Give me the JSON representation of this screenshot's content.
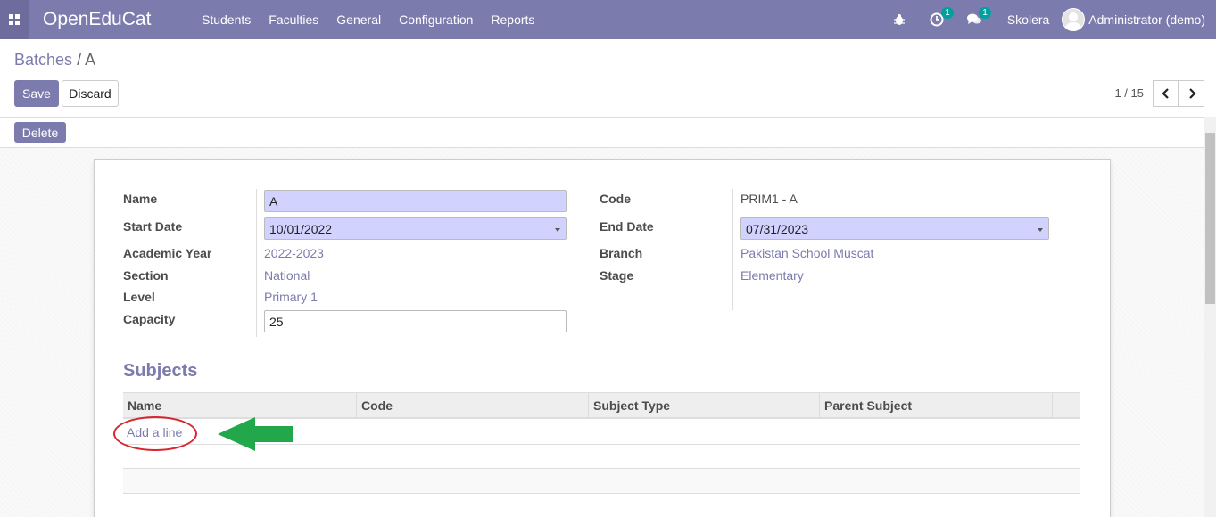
{
  "app": {
    "brand": "OpenEduCat"
  },
  "nav": {
    "menu": [
      "Students",
      "Faculties",
      "General",
      "Configuration",
      "Reports"
    ],
    "activity_badge": "1",
    "messages_badge": "1",
    "company": "Skolera",
    "user": "Administrator (demo)"
  },
  "breadcrumb": {
    "parent": "Batches",
    "separator": "/",
    "current": "A"
  },
  "toolbar": {
    "save": "Save",
    "discard": "Discard",
    "delete": "Delete"
  },
  "pager": {
    "value": "1 / 15"
  },
  "form": {
    "left": {
      "name_label": "Name",
      "name_value": "A",
      "start_date_label": "Start Date",
      "start_date_value": "10/01/2022",
      "academic_year_label": "Academic Year",
      "academic_year_value": "2022-2023",
      "section_label": "Section",
      "section_value": "National",
      "level_label": "Level",
      "level_value": "Primary 1",
      "capacity_label": "Capacity",
      "capacity_value": "25"
    },
    "right": {
      "code_label": "Code",
      "code_value": "PRIM1 - A",
      "end_date_label": "End Date",
      "end_date_value": "07/31/2023",
      "branch_label": "Branch",
      "branch_value": "Pakistan School Muscat",
      "stage_label": "Stage",
      "stage_value": "Elementary"
    }
  },
  "subjects": {
    "title": "Subjects",
    "columns": [
      "Name",
      "Code",
      "Subject Type",
      "Parent Subject"
    ],
    "add_line": "Add a line"
  },
  "colors": {
    "primary": "#7c7bad",
    "required_field": "#d2d2ff",
    "annotation_oval": "#d9252c",
    "annotation_arrow": "#22a84a"
  }
}
